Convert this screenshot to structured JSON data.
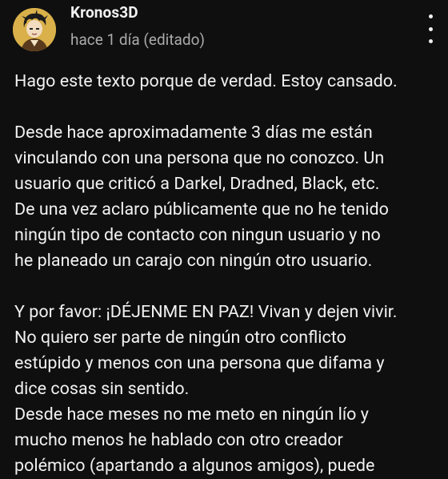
{
  "comment": {
    "author": "Kronos3D",
    "timestamp": "hace 1 día (editado)",
    "avatar_icon": "cartoon-avatar-icon",
    "menu_icon": "more-vertical-icon",
    "paragraphs": [
      {
        "lines": [
          "Hago este texto porque de verdad. Estoy cansado."
        ]
      },
      {
        "lines": [
          "Desde hace aproximadamente 3 días me están",
          "vinculando con una persona que no conozco. Un",
          "usuario que criticó a Darkel, Dradned, Black, etc.",
          "De una vez aclaro públicamente que no he tenido",
          "ningún tipo de contacto con ningun usuario y no",
          "he planeado un carajo con ningún otro usuario."
        ]
      },
      {
        "lines": [
          "Y por favor: ¡DÉJENME EN PAZ! Vivan y dejen vivir.",
          "No quiero ser parte de ningún otro conflicto",
          "estúpido y menos con una persona que difama y",
          "dice cosas sin sentido."
        ]
      },
      {
        "lines": [
          "Desde hace meses no me meto en ningún lío y",
          "mucho menos he hablado con otro creador",
          "polémico (apartando a algunos amigos), puede"
        ]
      }
    ]
  },
  "colors": {
    "background": "#0f0f0f",
    "text": "#f1f1f1",
    "secondary_text": "#aaaaaa"
  }
}
